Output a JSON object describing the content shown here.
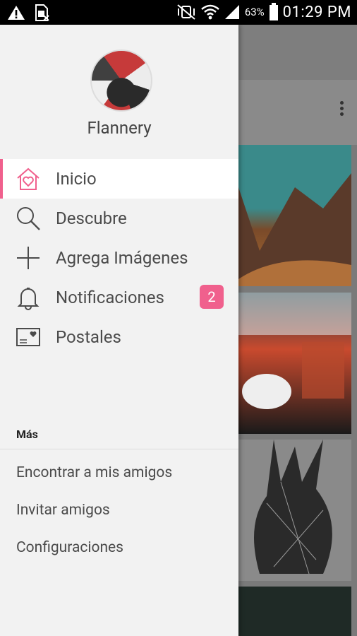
{
  "statusbar": {
    "battery_percent": "63%",
    "time": "01:29 PM"
  },
  "drawer": {
    "username": "Flannery",
    "menu": [
      {
        "label": "Inicio",
        "icon": "home-heart-icon",
        "active": true
      },
      {
        "label": "Descubre",
        "icon": "search-icon",
        "active": false
      },
      {
        "label": "Agrega Imágenes",
        "icon": "plus-icon",
        "active": false
      },
      {
        "label": "Notificaciones",
        "icon": "bell-icon",
        "active": false,
        "badge": "2"
      },
      {
        "label": "Postales",
        "icon": "postcard-icon",
        "active": false
      }
    ],
    "section_title": "Más",
    "more_items": [
      {
        "label": "Encontrar a mis amigos"
      },
      {
        "label": "Invitar amigos"
      },
      {
        "label": "Configuraciones"
      }
    ]
  },
  "colors": {
    "accent": "#f0608d",
    "drawer_bg": "#f2f2f2",
    "text": "#4b4b4b"
  }
}
